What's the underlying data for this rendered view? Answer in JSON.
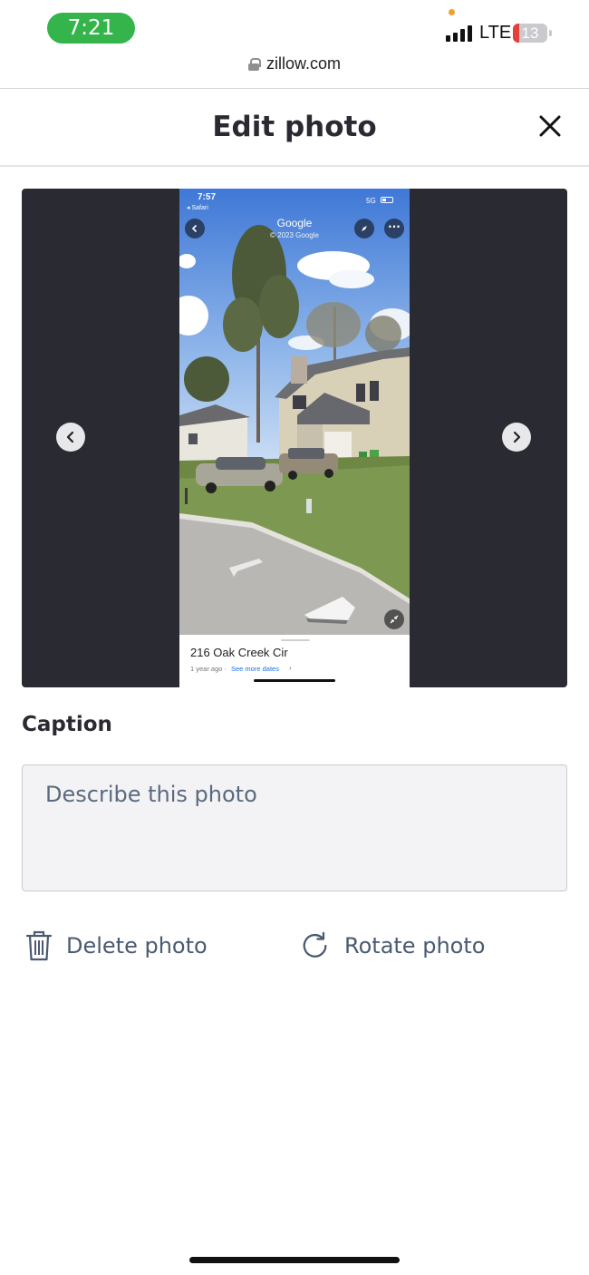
{
  "status_bar": {
    "time": "7:21",
    "network": "LTE",
    "battery": "13",
    "battery_color": "#e5403a",
    "time_pill_color": "#34b44a"
  },
  "browser": {
    "url": "zillow.com",
    "lock_icon": "lock-icon"
  },
  "header": {
    "title": "Edit photo",
    "close_icon": "close-icon"
  },
  "photo": {
    "prev_icon": "chevron-left-icon",
    "next_icon": "chevron-right-icon",
    "embedded_screenshot": {
      "time": "7:57",
      "back_app": "◂ Safari",
      "network": "5G",
      "map_title": "Google",
      "copyright": "© 2023 Google",
      "place_name": "216 Oak Creek Cir",
      "place_age": "1 year ago ·",
      "see_more": "See more dates",
      "chevron": "›"
    }
  },
  "caption": {
    "label": "Caption",
    "placeholder": "Describe this photo",
    "value": ""
  },
  "actions": {
    "delete_label": "Delete photo",
    "delete_icon": "trash-icon",
    "rotate_label": "Rotate photo",
    "rotate_icon": "rotate-icon"
  },
  "colors": {
    "viewer_background": "#2a2a33",
    "text_primary": "#2a2a33",
    "action_text": "#4a5a70"
  }
}
